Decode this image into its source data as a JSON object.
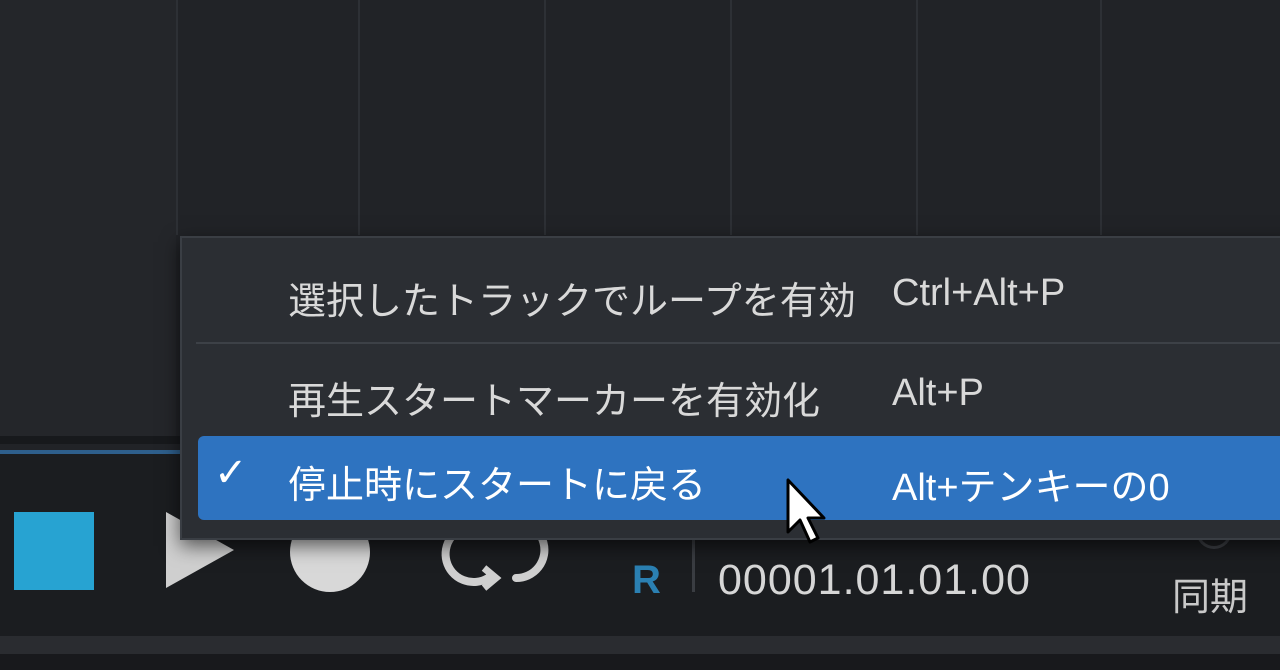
{
  "menu": {
    "items": [
      {
        "label": "選択したトラックでループを有効",
        "shortcut": "Ctrl+Alt+P",
        "checked": false,
        "highlighted": false
      },
      {
        "label": "再生スタートマーカーを有効化",
        "shortcut": "Alt+P",
        "checked": false,
        "highlighted": false
      },
      {
        "label": "停止時にスタートに戻る",
        "shortcut": "Alt+テンキーの0",
        "checked": true,
        "highlighted": true
      }
    ],
    "check_glyph": "✓"
  },
  "transport": {
    "r_label": "R",
    "time_value": "00001.01.01.00",
    "sync_label": "同期"
  },
  "colors": {
    "highlight": "#2e73c0",
    "stop_button": "#27a3d2",
    "r_label": "#2b80b2"
  },
  "icons": [
    "stop-icon",
    "play-icon",
    "record-icon",
    "loop-icon",
    "checkmark-icon",
    "mouse-cursor-icon"
  ]
}
